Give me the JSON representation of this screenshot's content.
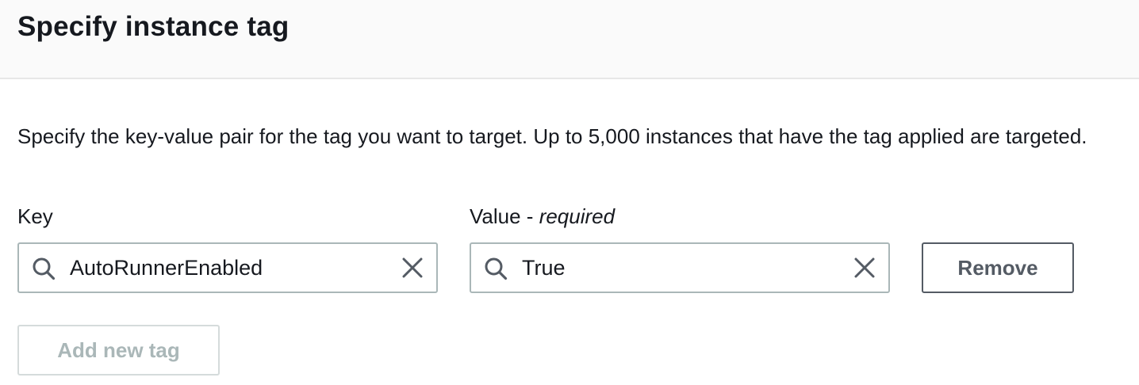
{
  "header": {
    "title": "Specify instance tag"
  },
  "description": "Specify the key-value pair for the tag you want to target. Up to 5,000 instances that have the tag applied are targeted.",
  "tag_row": {
    "key_label": "Key",
    "value_label": "Value - ",
    "value_required": "required",
    "key_value": "AutoRunnerEnabled",
    "value_value": "True",
    "remove_label": "Remove"
  },
  "add_button_label": "Add new tag",
  "icons": {
    "search": "search-icon",
    "clear": "close-icon"
  },
  "colors": {
    "text": "#16191f",
    "border": "#aab7b8",
    "button_border": "#545b64",
    "disabled": "#aab7b8",
    "header_bg": "#fafafa"
  }
}
